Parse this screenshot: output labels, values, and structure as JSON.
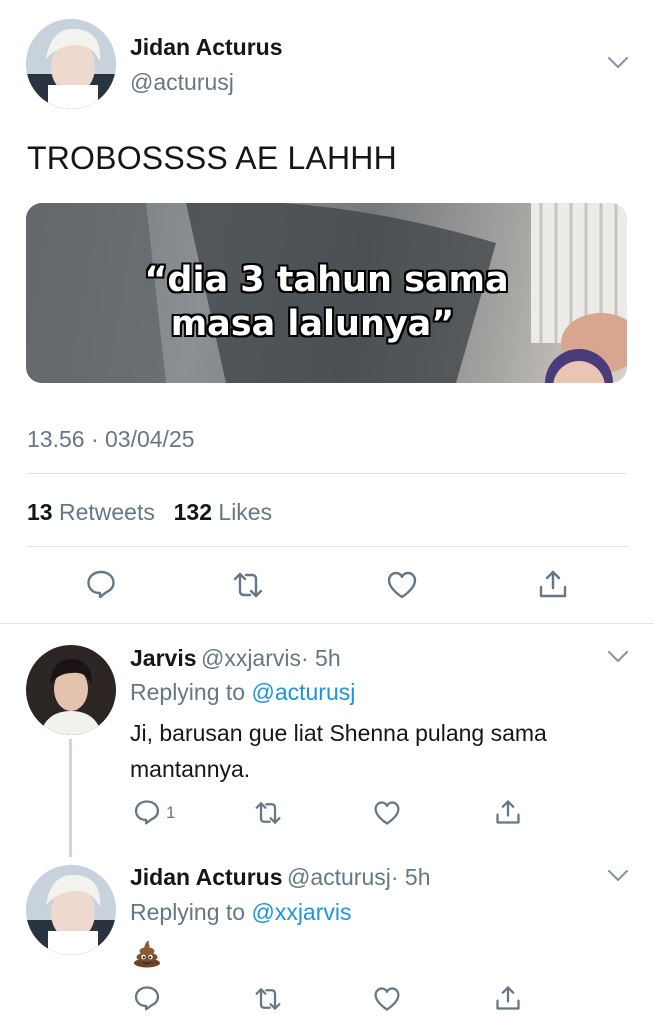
{
  "main_tweet": {
    "author_name": "Jidan Acturus",
    "author_handle": "@acturusj",
    "text": "TROBOSSSS AE LAHHH",
    "media_caption_line1": "“dia 3 tahun sama",
    "media_caption_line2": "masa lalunya”",
    "timestamp": "13.56 · 03/04/25",
    "retweets_count": "13",
    "retweets_label": "Retweets",
    "likes_count": "132",
    "likes_label": "Likes"
  },
  "replies": [
    {
      "author_name": "Jarvis",
      "author_handle": "@xxjarvis",
      "time": "· 5h",
      "replying_prefix": "Replying to",
      "replying_to": "@acturusj",
      "text_line1": "Ji, barusan gue liat Shenna pulang sama",
      "text_line2": "mantannya.",
      "reply_count": "1"
    },
    {
      "author_name": "Jidan Acturus",
      "author_handle": "@acturusj",
      "time": "· 5h",
      "replying_prefix": "Replying to",
      "replying_to": "@xxjarvis",
      "text": "💩"
    }
  ],
  "icons": {
    "reply": "reply-icon",
    "retweet": "retweet-icon",
    "like": "heart-icon",
    "share": "share-icon",
    "more": "chevron-down-icon"
  },
  "colors": {
    "link": "#1b95e0",
    "secondary_text": "#657786",
    "divider": "#e1e8ed"
  }
}
